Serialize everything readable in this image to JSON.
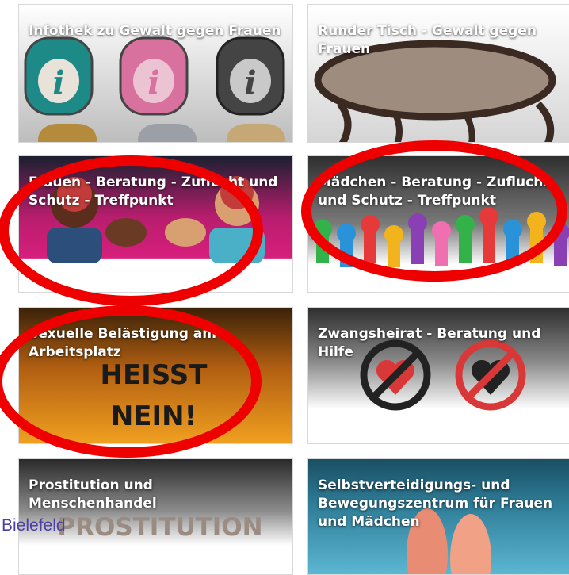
{
  "tiles": [
    {
      "key": "infothek",
      "title": "Infothek zu Gewalt gegen Frauen",
      "icon": "info-icon-buttons"
    },
    {
      "key": "runder-tisch",
      "title": "Runder Tisch - Gewalt gegen Frauen",
      "icon": "round-table-icon"
    },
    {
      "key": "frauen-beratung",
      "title": "Frauen - Beratung - Zuflucht und Schutz - Treffpunkt",
      "icon": "women-flexing-illustration"
    },
    {
      "key": "maedchen-beratung",
      "title": "Mädchen - Beratung - Zuflucht und Schutz - Treffpunkt",
      "icon": "raised-hands-illustration"
    },
    {
      "key": "belaestigung",
      "title": "Sexuelle Belästigung am Arbeitsplatz",
      "icon": "nein-heisst-nein-sign",
      "image_text": "HEISST NEIN!"
    },
    {
      "key": "zwangsheirat",
      "title": "Zwangsheirat - Beratung und Hilfe",
      "icon": "crossed-heart-icon"
    },
    {
      "key": "prostitution",
      "title": "Prostitution und Menschenhandel",
      "icon": "prostitution-wordmark",
      "image_text": "PROSTITUTION"
    },
    {
      "key": "selbstverteidigung",
      "title": "Selbstverteidigungs- und Bewegungszentrum für Frauen und Mädchen",
      "icon": "sneakers-image"
    }
  ],
  "overlay_label": "Bielefeld",
  "colors": {
    "annotation": "#ee0000",
    "overlay_text": "#4b3fa8"
  }
}
